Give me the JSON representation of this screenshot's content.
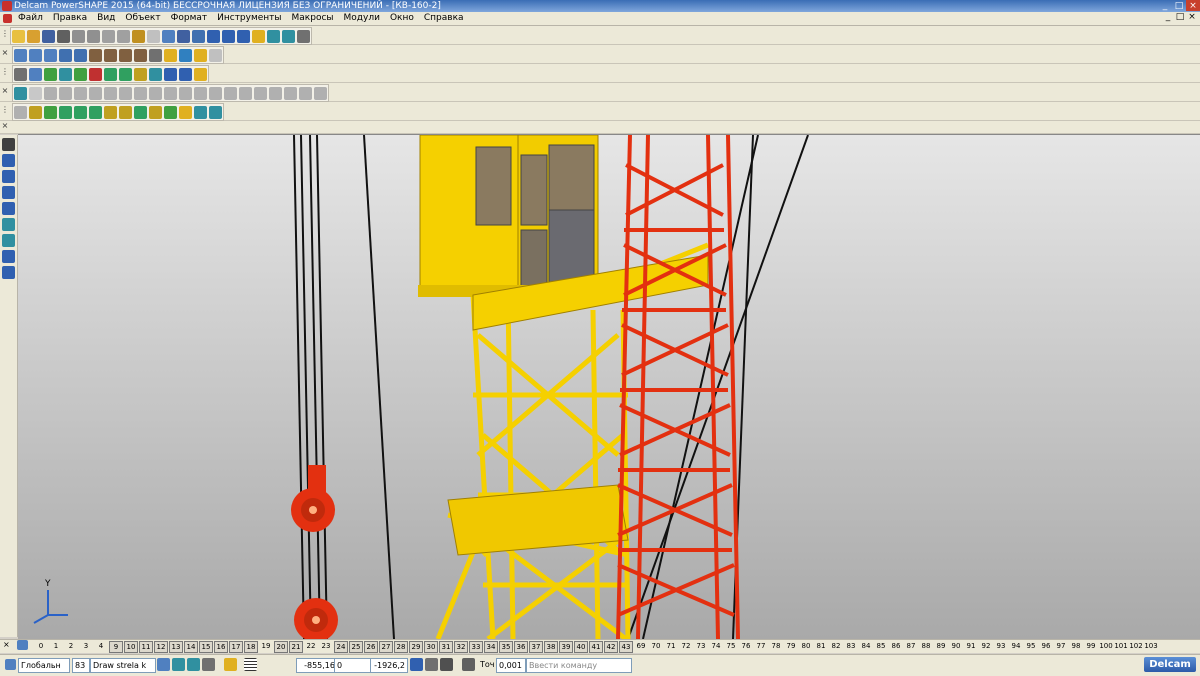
{
  "window": {
    "title": "Delcam PowerSHAPE 2015 (64-bit) БЕССРОЧНАЯ ЛИЦЕНЗИЯ БЕЗ ОГРАНИЧЕНИЙ - [КВ-160-2]",
    "controls": [
      "_",
      "□",
      "×"
    ]
  },
  "menu": {
    "items": [
      "Файл",
      "Правка",
      "Вид",
      "Объект",
      "Формат",
      "Инструменты",
      "Макросы",
      "Модули",
      "Окно",
      "Справка"
    ],
    "doc_controls": [
      "_",
      "□",
      "×"
    ]
  },
  "toolbars": {
    "row1": [
      {
        "icon": "new-icon",
        "color": "#e8c040"
      },
      {
        "icon": "open-icon",
        "color": "#d8a030"
      },
      {
        "icon": "save-icon",
        "color": "#4060a0"
      },
      {
        "icon": "print-icon",
        "color": "#606060"
      },
      {
        "icon": "cut-icon",
        "color": "#909090"
      },
      {
        "icon": "copy-icon",
        "color": "#909090"
      },
      {
        "icon": "paste-icon",
        "color": "#a0a0a0"
      },
      {
        "icon": "delete-icon",
        "color": "#a0a0a0"
      },
      {
        "icon": "undo-icon",
        "color": "#c09020"
      },
      {
        "icon": "redo-icon",
        "color": "#c0c0c0"
      },
      {
        "icon": "measure-icon",
        "color": "#5080c0"
      },
      {
        "icon": "select-icon",
        "color": "#4060a0"
      },
      {
        "icon": "line-icon",
        "color": "#4070b0"
      },
      {
        "icon": "circle-icon",
        "color": "#3060b0"
      },
      {
        "icon": "curve-icon",
        "color": "#3060b0"
      },
      {
        "icon": "text-icon",
        "color": "#3060b0"
      },
      {
        "icon": "surface-icon",
        "color": "#e0b020"
      },
      {
        "icon": "solid-icon",
        "color": "#3090a0"
      },
      {
        "icon": "mesh-icon",
        "color": "#3090a0"
      },
      {
        "icon": "tools-icon",
        "color": "#707070"
      }
    ],
    "row2": [
      {
        "icon": "view-top-icon",
        "color": "#5080c0"
      },
      {
        "icon": "view-front-icon",
        "color": "#5080c0"
      },
      {
        "icon": "view-iso-icon",
        "color": "#5080c0"
      },
      {
        "icon": "view-box-icon",
        "color": "#4070b0"
      },
      {
        "icon": "view-fit-icon",
        "color": "#4070b0"
      },
      {
        "icon": "zoom-in-icon",
        "color": "#806040"
      },
      {
        "icon": "zoom-out-icon",
        "color": "#806040"
      },
      {
        "icon": "zoom-box-icon",
        "color": "#806040"
      },
      {
        "icon": "zoom-all-icon",
        "color": "#806040"
      },
      {
        "icon": "globe-icon",
        "color": "#707070"
      },
      {
        "icon": "shaded-icon",
        "color": "#e0b020"
      },
      {
        "icon": "wireframe-icon",
        "color": "#3080c0"
      },
      {
        "icon": "light-icon",
        "color": "#e0b020"
      },
      {
        "icon": "hand-icon",
        "color": "#c0c0c0"
      }
    ],
    "row3": [
      {
        "icon": "calculator-icon",
        "color": "#707070"
      },
      {
        "icon": "document-icon",
        "color": "#5080c0"
      },
      {
        "icon": "pencil-icon",
        "color": "#40a040"
      },
      {
        "icon": "sphere-icon",
        "color": "#3090a0"
      },
      {
        "icon": "green-ball-icon",
        "color": "#40a040"
      },
      {
        "icon": "red-ball-icon",
        "color": "#c03030"
      },
      {
        "icon": "play-icon",
        "color": "#30a060"
      },
      {
        "icon": "arrow-icon",
        "color": "#30a060"
      },
      {
        "icon": "cube-icon",
        "color": "#c0a020"
      },
      {
        "icon": "frame-icon",
        "color": "#3090a0"
      },
      {
        "icon": "info-icon",
        "color": "#3060b0"
      },
      {
        "icon": "box-icon",
        "color": "#3060b0"
      },
      {
        "icon": "move-icon",
        "color": "#e0b020"
      }
    ],
    "row4": [
      {
        "icon": "wizard-icon",
        "color": "#3090a0"
      },
      {
        "icon": "disabled-icon",
        "color": "#c8c8c8"
      },
      {
        "icon": "solid-box-icon",
        "color": "#b0b0b0"
      },
      {
        "icon": "solid-cyl-icon",
        "color": "#b0b0b0"
      },
      {
        "icon": "solid-sel-icon",
        "color": "#b0b0b0"
      },
      {
        "icon": "solid-cone-icon",
        "color": "#b0b0b0"
      },
      {
        "icon": "solid-torus-icon",
        "color": "#b0b0b0"
      },
      {
        "icon": "solid-ext-icon",
        "color": "#b0b0b0"
      },
      {
        "icon": "solid-rev-icon",
        "color": "#b0b0b0"
      },
      {
        "icon": "solid-bool1-icon",
        "color": "#b0b0b0"
      },
      {
        "icon": "solid-bool2-icon",
        "color": "#b0b0b0"
      },
      {
        "icon": "solid-bool3-icon",
        "color": "#b0b0b0"
      },
      {
        "icon": "solid-fillet-icon",
        "color": "#b0b0b0"
      },
      {
        "icon": "solid-chamfer-icon",
        "color": "#b0b0b0"
      },
      {
        "icon": "solid-shell-icon",
        "color": "#b0b0b0"
      },
      {
        "icon": "solid-draft-icon",
        "color": "#b0b0b0"
      },
      {
        "icon": "solid-split-icon",
        "color": "#b0b0b0"
      },
      {
        "icon": "solid-tree-icon",
        "color": "#b0b0b0"
      },
      {
        "icon": "solid-feat1-icon",
        "color": "#b0b0b0"
      },
      {
        "icon": "solid-feat2-icon",
        "color": "#b0b0b0"
      },
      {
        "icon": "solid-feat3-icon",
        "color": "#b0b0b0"
      }
    ],
    "row5": [
      {
        "icon": "surf-plane-icon",
        "color": "#b0b0b0"
      },
      {
        "icon": "surf-curve-icon",
        "color": "#c0a020"
      },
      {
        "icon": "surf-xy-icon",
        "color": "#40a040"
      },
      {
        "icon": "surf-cube-icon",
        "color": "#30a060"
      },
      {
        "icon": "surf-cyl-icon",
        "color": "#30a060"
      },
      {
        "icon": "surf-disc-icon",
        "color": "#30a060"
      },
      {
        "icon": "surf-cone-icon",
        "color": "#c0a020"
      },
      {
        "icon": "surf-sphere-icon",
        "color": "#c0a020"
      },
      {
        "icon": "surf-torus-icon",
        "color": "#30a060"
      },
      {
        "icon": "surf-spring-icon",
        "color": "#c0a020"
      },
      {
        "icon": "surf-power-icon",
        "color": "#40a040"
      },
      {
        "icon": "surf-blend-icon",
        "color": "#e0b020"
      },
      {
        "icon": "surf-fill-icon",
        "color": "#3090a0"
      },
      {
        "icon": "surf-extend-icon",
        "color": "#3090a0"
      }
    ],
    "left": [
      {
        "icon": "pointer-icon",
        "color": "#404040"
      },
      {
        "icon": "wire-select-icon",
        "color": "#3060b0"
      },
      {
        "icon": "point-icon",
        "color": "#3060b0"
      },
      {
        "icon": "arc-icon",
        "color": "#3060b0"
      },
      {
        "icon": "workplane-icon",
        "color": "#3060b0"
      },
      {
        "icon": "surface-tool-icon",
        "color": "#3090a0"
      },
      {
        "icon": "solid-tool-icon",
        "color": "#3090a0"
      },
      {
        "icon": "axis-icon",
        "color": "#3060b0"
      },
      {
        "icon": "dimension-icon",
        "color": "#3060b0"
      }
    ]
  },
  "levels": [
    "0",
    "1",
    "2",
    "3",
    "4",
    "9",
    "10",
    "11",
    "12",
    "13",
    "14",
    "15",
    "16",
    "17",
    "18",
    "19",
    "20",
    "21",
    "22",
    "23",
    "24",
    "25",
    "26",
    "27",
    "28",
    "29",
    "30",
    "31",
    "32",
    "33",
    "34",
    "35",
    "36",
    "37",
    "38",
    "39",
    "40",
    "41",
    "42",
    "43",
    "69",
    "70",
    "71",
    "72",
    "73",
    "74",
    "75",
    "76",
    "77",
    "78",
    "79",
    "80",
    "81",
    "82",
    "83",
    "84",
    "85",
    "86",
    "87",
    "88",
    "89",
    "90",
    "91",
    "92",
    "93",
    "94",
    "95",
    "96",
    "97",
    "98",
    "99",
    "100",
    "101",
    "102",
    "103"
  ],
  "levels_boxed": [
    "9",
    "10",
    "11",
    "12",
    "13",
    "14",
    "15",
    "16",
    "17",
    "18",
    "20",
    "21",
    "24",
    "25",
    "26",
    "27",
    "28",
    "29",
    "30",
    "31",
    "32",
    "33",
    "34",
    "35",
    "36",
    "37",
    "38",
    "39",
    "40",
    "41",
    "42",
    "43"
  ],
  "status": {
    "workplane": "Глобальн",
    "level_number": "83",
    "level_name": "Draw strela k",
    "coord_x": "-855,16",
    "coord_y": "0",
    "coord_z": "-1926,2",
    "tolerance_label": "Точ",
    "tolerance_value": "0,001",
    "command_placeholder": "Ввести команду",
    "logo": "Delcam"
  },
  "viewport": {
    "axis_label": "Y",
    "colors": {
      "yellow": "#f5d000",
      "red": "#e33010",
      "cable": "#111111",
      "glass": "#8a7a60",
      "dark_hook": "#333333"
    }
  }
}
